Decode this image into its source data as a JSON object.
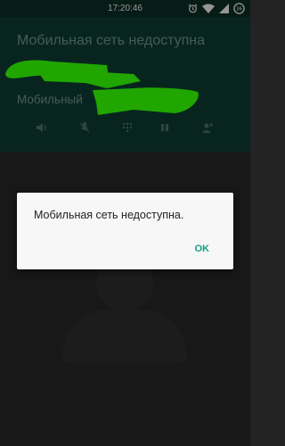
{
  "status_bar": {
    "time": "17:20:46",
    "icons": [
      "alarm-icon",
      "wifi-icon",
      "signal-icon",
      "battery-icon"
    ],
    "battery_label": "36"
  },
  "call": {
    "status_text": "Мобильная сеть недоступна",
    "network_label": "Мобильный",
    "redaction_color": "#33ff00",
    "controls": [
      "speaker-icon",
      "mute-icon",
      "dialpad-icon",
      "hold-icon",
      "add-call-icon"
    ]
  },
  "dialog": {
    "message": "Мобильная сеть недоступна.",
    "ok_label": "OK",
    "accent_color": "#15a085"
  }
}
